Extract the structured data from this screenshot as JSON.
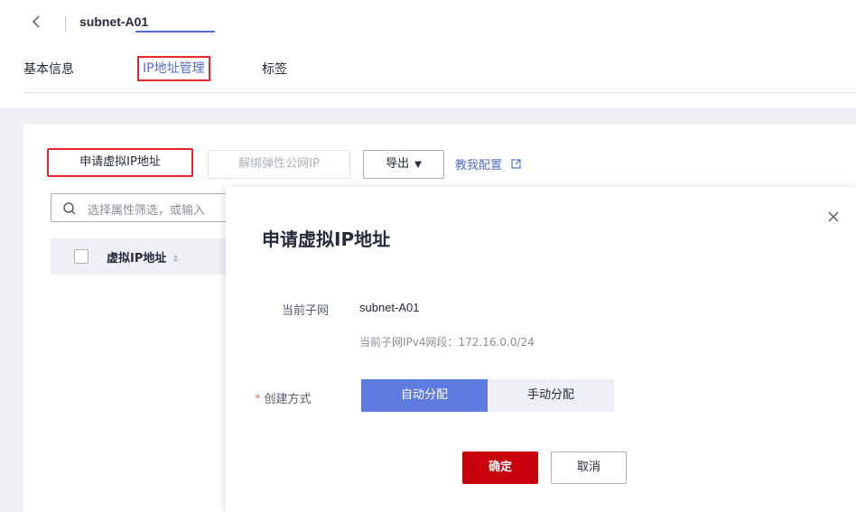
{
  "header": {
    "title": "subnet-A01"
  },
  "tabs": [
    {
      "label": "基本信息"
    },
    {
      "label": "IP地址管理"
    },
    {
      "label": "标签"
    }
  ],
  "toolbar": {
    "apply_vip_label": "申请虚拟IP地址",
    "unbind_eip_label": "解绑弹性公网IP",
    "export_label": "导出",
    "guide_link": "教我配置"
  },
  "search": {
    "placeholder": "选择属性筛选，或输入"
  },
  "table": {
    "columns": [
      "虚拟IP地址"
    ]
  },
  "modal": {
    "title": "申请虚拟IP地址",
    "current_subnet_label": "当前子网",
    "current_subnet_value": "subnet-A01",
    "subnet_hint": "当前子网IPv4网段：172.16.0.0/24",
    "create_mode_label": "创建方式",
    "required_mark": "*",
    "mode_auto": "自动分配",
    "mode_manual": "手动分配",
    "ok_label": "确定",
    "cancel_label": "取消"
  },
  "colors": {
    "accent": "#526ecc",
    "primary_button": "#c7000b",
    "highlight_box": "#e5262c",
    "segment_selected": "#5e7ce0"
  }
}
